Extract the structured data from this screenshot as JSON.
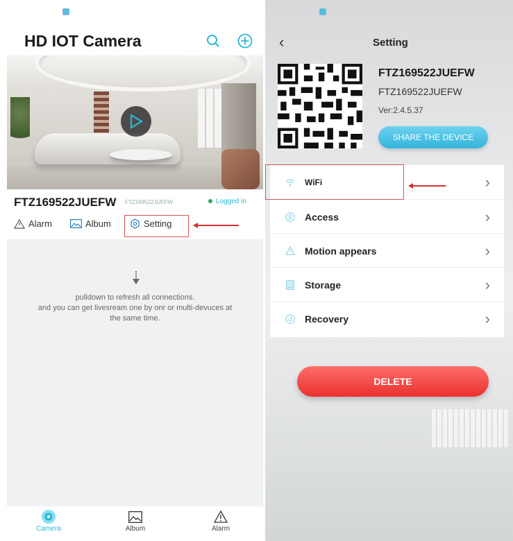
{
  "left": {
    "title": "HD IOT Camera",
    "device": {
      "name": "FTZ169522JUEFW",
      "id": "FTZ169522JUEFW",
      "status": "Logged in"
    },
    "actions": {
      "alarm": "Alarm",
      "album": "Album",
      "setting": "Setting"
    },
    "hint_lines": [
      "pulldown to refresh all connections.",
      "and you can get livesream one by onr or multi-devuces at",
      "the same time."
    ],
    "tabs": {
      "camera": "Camera",
      "album": "Album",
      "alarm": "Alarm"
    }
  },
  "right": {
    "title": "Setting",
    "device_name": "FTZ169522JUEFW",
    "device_id": "FTZ169522JUEFW",
    "version": "Ver:2.4.5.37",
    "share_label": "SHARE THE DEVICE",
    "menu": [
      {
        "label": "WiFi",
        "icon": "wifi-icon"
      },
      {
        "label": "Access",
        "icon": "user-icon"
      },
      {
        "label": "Motion appears",
        "icon": "warning-icon"
      },
      {
        "label": "Storage",
        "icon": "storage-icon"
      },
      {
        "label": "Recovery",
        "icon": "recovery-icon"
      }
    ],
    "delete_label": "DELETE"
  },
  "colors": {
    "accent": "#29b6d6",
    "delete": "#e8312e",
    "annotation": "#d32f2f"
  }
}
